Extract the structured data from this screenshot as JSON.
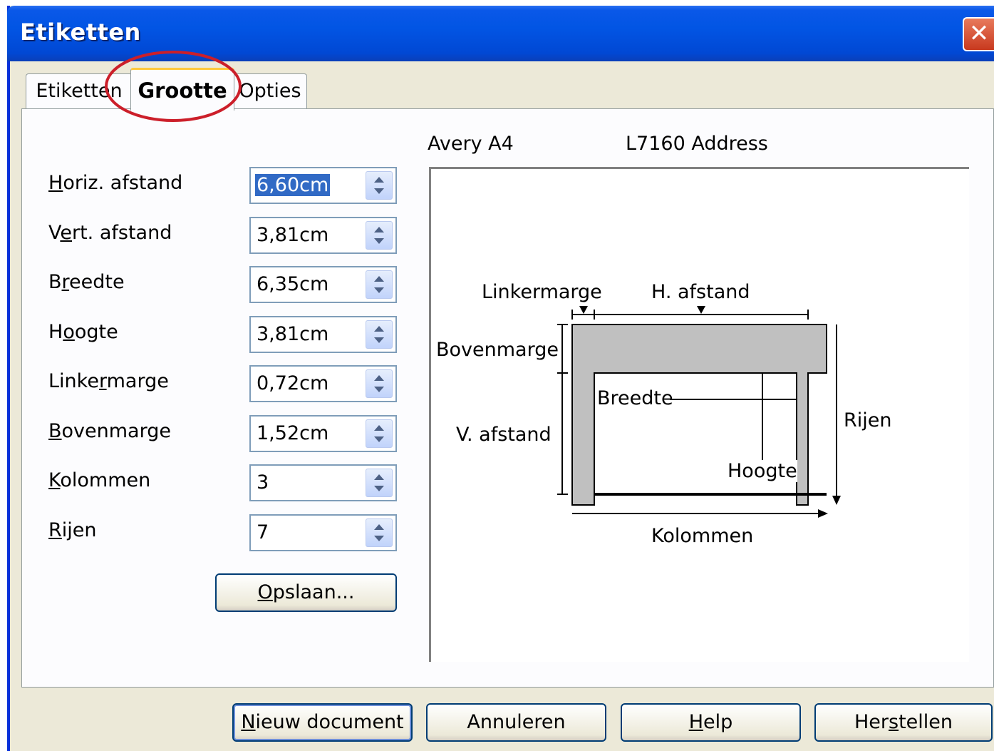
{
  "window": {
    "title": "Etiketten",
    "close": "✕"
  },
  "tabs": [
    {
      "label": "Etiketten",
      "active": false
    },
    {
      "label": "Grootte",
      "active": true
    },
    {
      "label": "Opties",
      "active": false
    }
  ],
  "fields": [
    {
      "label": "Horiz. afstand",
      "value": "6,60cm",
      "selected": true
    },
    {
      "label": "Vert. afstand",
      "value": "3,81cm"
    },
    {
      "label": "Breedte",
      "value": "6,35cm"
    },
    {
      "label": "Hoogte",
      "value": "3,81cm"
    },
    {
      "label": "Linkermarge",
      "value": "0,72cm"
    },
    {
      "label": "Bovenmarge",
      "value": "1,52cm"
    },
    {
      "label": "Kolommen",
      "value": "3"
    },
    {
      "label": "Rijen",
      "value": "7"
    }
  ],
  "save_button": "Opslaan...",
  "preview": {
    "brand": "Avery A4",
    "type": "L7160 Address",
    "labels": {
      "linkermarge": "Linkermarge",
      "h_afstand": "H. afstand",
      "bovenmarge": "Bovenmarge",
      "breedte": "Breedte",
      "rijen": "Rijen",
      "v_afstand": "V. afstand",
      "hoogte": "Hoogte",
      "kolommen": "Kolommen"
    }
  },
  "buttons": {
    "new_document": "Nieuw document",
    "cancel": "Annuleren",
    "help": "Help",
    "reset": "Herstellen"
  },
  "colors": {
    "titlebar": "#0255e4",
    "annotation_circle": "#cc1f2a",
    "selection": "#316ac5"
  }
}
